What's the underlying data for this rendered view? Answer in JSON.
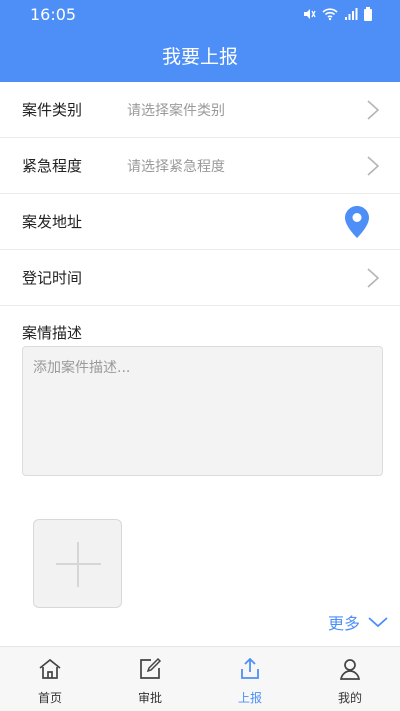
{
  "status_bar": {
    "time": "16:05"
  },
  "header": {
    "title": "我要上报"
  },
  "form": {
    "case_type": {
      "label": "案件类别",
      "placeholder": "请选择案件类别"
    },
    "urgency": {
      "label": "紧急程度",
      "placeholder": "请选择紧急程度"
    },
    "address": {
      "label": "案发地址"
    },
    "register_time": {
      "label": "登记时间"
    },
    "description": {
      "label": "案情描述",
      "placeholder": "添加案件描述..."
    },
    "more_label": "更多"
  },
  "tabs": [
    {
      "label": "首页",
      "icon": "home-icon"
    },
    {
      "label": "审批",
      "icon": "edit-icon"
    },
    {
      "label": "上报",
      "icon": "upload-icon",
      "active": true
    },
    {
      "label": "我的",
      "icon": "user-icon"
    }
  ],
  "colors": {
    "accent": "#4d8ff7",
    "header_bg": "#4d8ff7"
  }
}
